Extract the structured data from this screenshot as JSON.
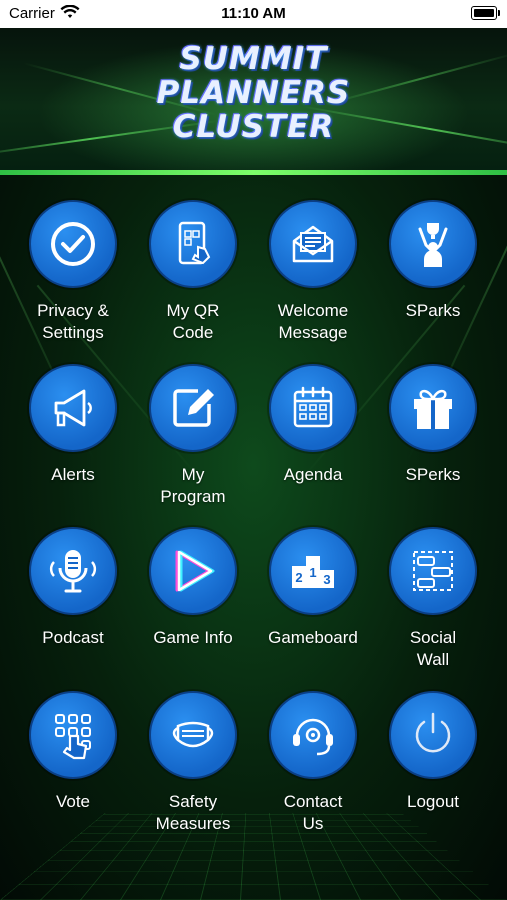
{
  "status_bar": {
    "carrier": "Carrier",
    "time": "11:10 AM"
  },
  "header": {
    "logo_line1": "SUMMIT",
    "logo_line2": "PLANNERS",
    "logo_line3": "CLUSTER"
  },
  "menu": [
    {
      "label": "Privacy &\nSettings",
      "icon": "check-circle-icon"
    },
    {
      "label": "My QR\nCode",
      "icon": "qr-phone-icon"
    },
    {
      "label": "Welcome\nMessage",
      "icon": "envelope-icon"
    },
    {
      "label": "SParks",
      "icon": "trophy-person-icon"
    },
    {
      "label": "Alerts",
      "icon": "megaphone-icon"
    },
    {
      "label": "My\nProgram",
      "icon": "edit-icon"
    },
    {
      "label": "Agenda",
      "icon": "calendar-icon"
    },
    {
      "label": "SPerks",
      "icon": "gift-icon"
    },
    {
      "label": "Podcast",
      "icon": "microphone-icon"
    },
    {
      "label": "Game Info",
      "icon": "play-icon"
    },
    {
      "label": "Gameboard",
      "icon": "podium-icon"
    },
    {
      "label": "Social\nWall",
      "icon": "chat-board-icon"
    },
    {
      "label": "Vote",
      "icon": "vote-tap-icon"
    },
    {
      "label": "Safety\nMeasures",
      "icon": "mask-icon"
    },
    {
      "label": "Contact\nUs",
      "icon": "headset-icon"
    },
    {
      "label": "Logout",
      "icon": "power-icon"
    }
  ],
  "colors": {
    "circle": "#1a73d9",
    "background": "#06200c",
    "accent_green": "#5dff5d"
  }
}
